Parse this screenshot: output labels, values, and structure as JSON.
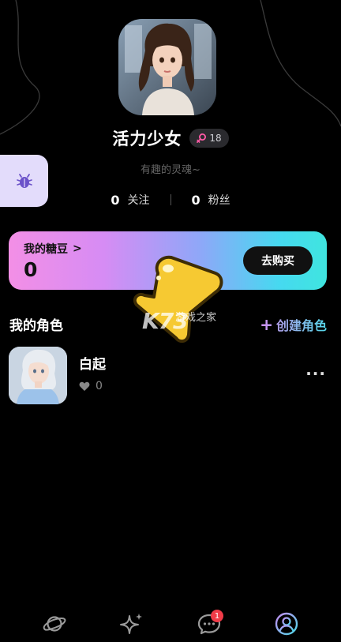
{
  "profile": {
    "name": "活力少女",
    "age": "18",
    "bio": "有趣的灵魂~"
  },
  "stats": {
    "following_count": "0",
    "following_label": "关注",
    "fans_count": "0",
    "fans_label": "粉丝"
  },
  "candy": {
    "title": "我的糖豆",
    "chevron": ">",
    "amount": "0",
    "buy_label": "去购买"
  },
  "roles_section": {
    "title": "我的角色",
    "create_plus": "+",
    "create_label": "创建角色"
  },
  "roles": [
    {
      "name": "白起",
      "likes": "0",
      "more": "···"
    }
  ],
  "watermark": {
    "logo": "K73",
    "subtitle": "游戏之家"
  },
  "tabbar": {
    "messages_badge": "1",
    "items": [
      "planet-icon",
      "sparkle-icon",
      "chat-icon",
      "profile-icon"
    ],
    "active": "profile-icon"
  },
  "colors": {
    "accent_gradient_start": "#f38fe6",
    "accent_gradient_end": "#3fe5df",
    "badge_red": "#f13b48",
    "active_tab": "#5fc8f0"
  }
}
